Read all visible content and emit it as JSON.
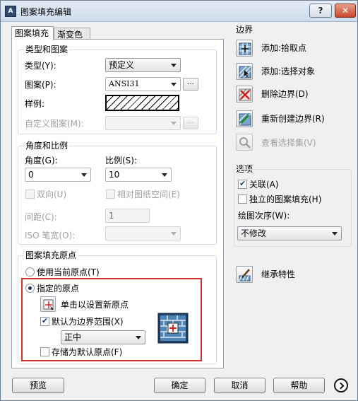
{
  "window": {
    "title": "图案填充编辑",
    "help_label": "?",
    "close_label": "✕",
    "app_icon_label": "A"
  },
  "tabs": [
    {
      "label": "图案填充"
    },
    {
      "label": "渐变色"
    }
  ],
  "type_pattern": {
    "title": "类型和图案",
    "type_label": "类型(Y):",
    "type_value": "预定义",
    "pattern_label": "图案(P):",
    "pattern_value": "ANSI31",
    "pattern_browse": "...",
    "sample_label": "样例:",
    "custom_label": "自定义图案(M):",
    "custom_browse": "..."
  },
  "angle_scale": {
    "title": "角度和比例",
    "angle_label": "角度(G):",
    "angle_value": "0",
    "scale_label": "比例(S):",
    "scale_value": "10",
    "double_label": "双向(U)",
    "relative_label": "相对图纸空间(E)",
    "spacing_label": "间距(C):",
    "spacing_value": "1",
    "iso_label": "ISO 笔宽(O):"
  },
  "origin": {
    "title": "图案填充原点",
    "use_current_label": "使用当前原点(T)",
    "specified_label": "指定的原点",
    "click_set_label": "单击以设置新原点",
    "default_extents_label": "默认为边界范围(X)",
    "extents_value": "正中",
    "store_default_label": "存储为默认原点(F)"
  },
  "boundaries": {
    "title": "边界",
    "add_pick_label": "添加:拾取点",
    "add_select_label": "添加:选择对象",
    "remove_label": "删除边界(D)",
    "recreate_label": "重新创建边界(R)",
    "view_label": "查看选择集(V)"
  },
  "options": {
    "title": "选项",
    "associative_label": "关联(A)",
    "independent_label": "独立的图案填充(H)",
    "draw_order_label": "绘图次序(W):",
    "draw_order_value": "不修改"
  },
  "inherit_label": "继承特性",
  "footer": {
    "preview": "预览",
    "ok": "确定",
    "cancel": "取消",
    "help": "帮助"
  },
  "state": {
    "associative": true,
    "independent": false,
    "double": false,
    "relative": false,
    "default_extents": true,
    "store_default": false,
    "origin_mode": "specified"
  }
}
